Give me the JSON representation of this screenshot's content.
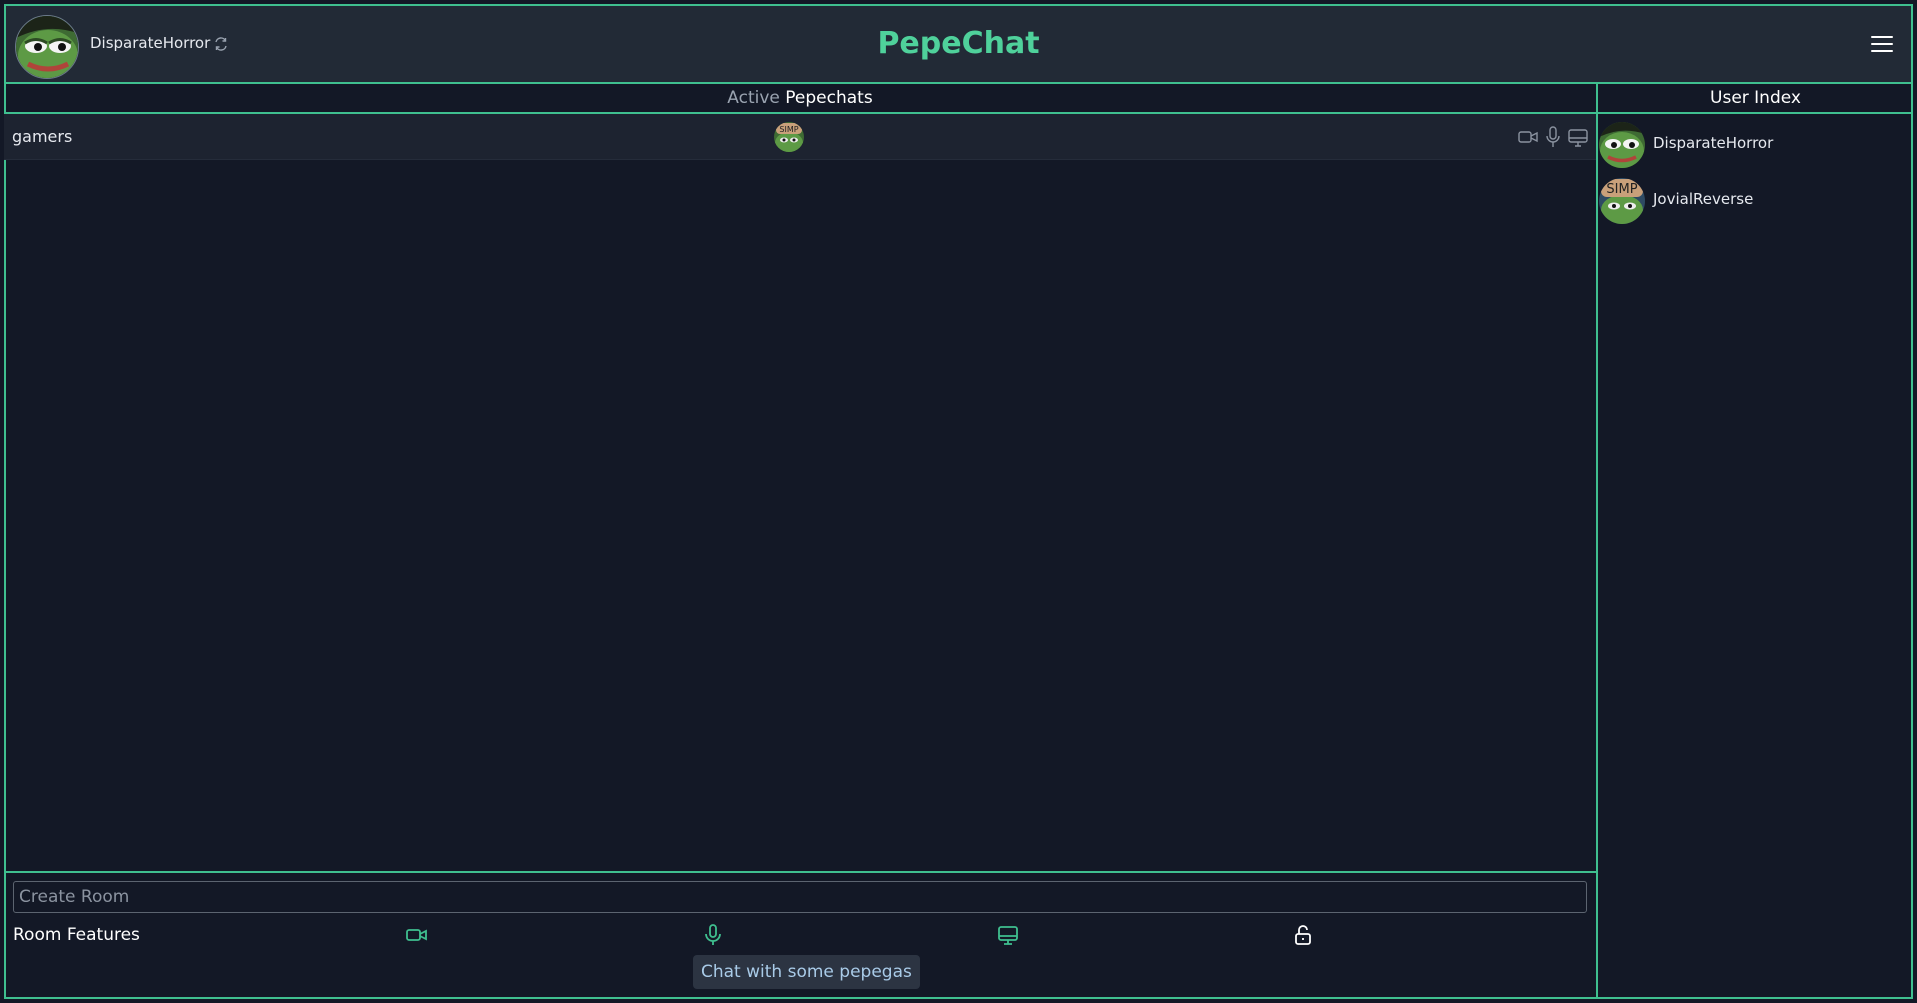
{
  "header": {
    "username": "DisparateHorror",
    "app_title": "PepeChat"
  },
  "main": {
    "section_title_prefix": "Active",
    "section_title_main": "Pepechats",
    "rooms": [
      {
        "name": "gamers",
        "avatar": "simp-pepe-avatar",
        "features": [
          "video-icon",
          "mic-icon",
          "screen-icon"
        ]
      }
    ],
    "create": {
      "placeholder": "Create Room",
      "features_label": "Room Features",
      "feature_icons": [
        "video-icon",
        "mic-icon",
        "screen-icon",
        "lock-icon"
      ],
      "tooltip": "Chat with some pepegas"
    }
  },
  "sidebar": {
    "title": "User Index",
    "users": [
      {
        "name": "DisparateHorror",
        "avatar": "pepe-avatar"
      },
      {
        "name": "JovialReverse",
        "avatar": "simp-pepe-avatar"
      }
    ]
  },
  "colors": {
    "accent": "#3fbf8f",
    "title": "#4fd19b",
    "background": "#131826",
    "header": "#222a36"
  }
}
